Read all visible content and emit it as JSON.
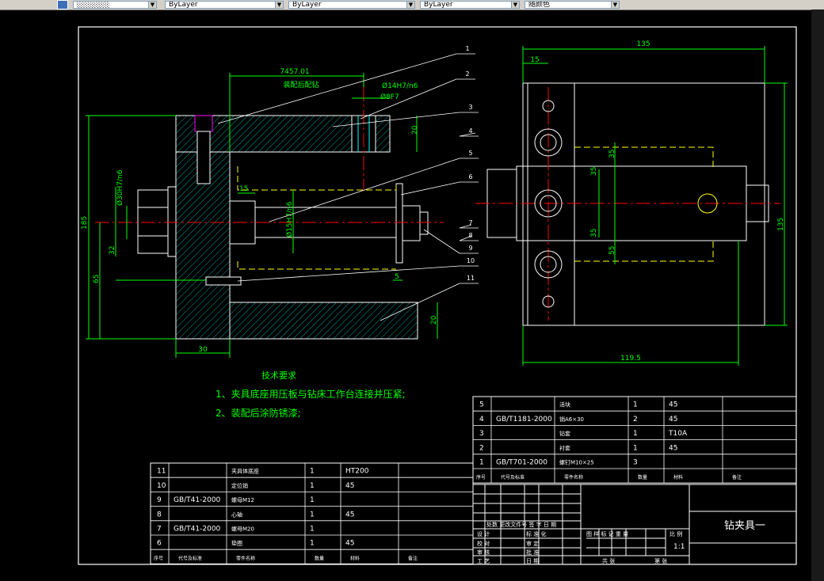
{
  "toolbar": {
    "combo1": "░░░░░░",
    "combo2": "ByLayer",
    "combo3": "ByLayer",
    "combo4": "ByLayer",
    "combo5": "随颜色"
  },
  "dims": {
    "d_7457": "7457.01",
    "assembly_note": "装配后配钻",
    "phi14": "Ø14H7/n6",
    "phi8": "Ø8F7",
    "d20_top": "20",
    "d15_left": "15",
    "d185": "185",
    "phi30": "Ø30H7/n6",
    "d32": "32",
    "d65": "65",
    "phi15": "Ø15H7/n6",
    "d5": "5",
    "d20_bot": "20",
    "d30": "30",
    "d135_top": "135",
    "d15_top": "15",
    "d35a": "35",
    "d35b": "35",
    "d35c": "35",
    "d55": "55",
    "d135_right": "135",
    "d119": "119.5"
  },
  "leaders": [
    "1",
    "2",
    "3",
    "4",
    "5",
    "6",
    "7",
    "8",
    "9",
    "10",
    "11"
  ],
  "tech": {
    "title": "技术要求",
    "line1": "1、夹具底座用压板与钻床工作台连接并压紧;",
    "line2": "2、装配后涂防锈漆;"
  },
  "bom_upper": [
    {
      "no": "5",
      "std": "",
      "name": "活块",
      "qty": "1",
      "mat": "45"
    },
    {
      "no": "4",
      "std": "GB/T1181-2000",
      "name": "销A6×30",
      "qty": "2",
      "mat": "45"
    },
    {
      "no": "3",
      "std": "",
      "name": "钻套",
      "qty": "1",
      "mat": "T10A"
    },
    {
      "no": "2",
      "std": "",
      "name": "衬套",
      "qty": "1",
      "mat": "45"
    },
    {
      "no": "1",
      "std": "GB/T701-2000",
      "name": "螺钉M10×25",
      "qty": "3",
      "mat": ""
    }
  ],
  "bom_upper_header": {
    "no": "序号",
    "std": "代号及标准",
    "name": "零件名称",
    "qty": "数量",
    "mat": "材料",
    "note": "备注"
  },
  "bom_lower": [
    {
      "no": "11",
      "std": "",
      "name": "夹具体底座",
      "qty": "1",
      "mat": "HT200"
    },
    {
      "no": "10",
      "std": "",
      "name": "定位销",
      "qty": "1",
      "mat": "45"
    },
    {
      "no": "9",
      "std": "GB/T41-2000",
      "name": "螺母M12",
      "qty": "1",
      "mat": ""
    },
    {
      "no": "8",
      "std": "",
      "name": "心轴",
      "qty": "1",
      "mat": "45"
    },
    {
      "no": "7",
      "std": "GB/T41-2000",
      "name": "螺母M20",
      "qty": "1",
      "mat": ""
    },
    {
      "no": "6",
      "std": "",
      "name": "垫圈",
      "qty": "1",
      "mat": "45"
    }
  ],
  "bom_lower_header": {
    "no": "序号",
    "std": "代号及标准",
    "name": "零件名称",
    "qty": "数量",
    "mat": "材料",
    "note": "备注"
  },
  "title_block": {
    "drawing_name": "钻夹具一",
    "scale": "1:1",
    "row_change": "处数  更改文件号    签 字  日 期",
    "design": "设 计",
    "check": "校 对",
    "audit": "审 核",
    "process": "工 艺",
    "std_check": "标 准 化",
    "approve": "审 定",
    "approve2": "批 准",
    "date": "日 期",
    "stage": "图 样 标 记  重 量",
    "ratio": "比 例",
    "sheets": "共  张",
    "sheet": "第  张"
  }
}
